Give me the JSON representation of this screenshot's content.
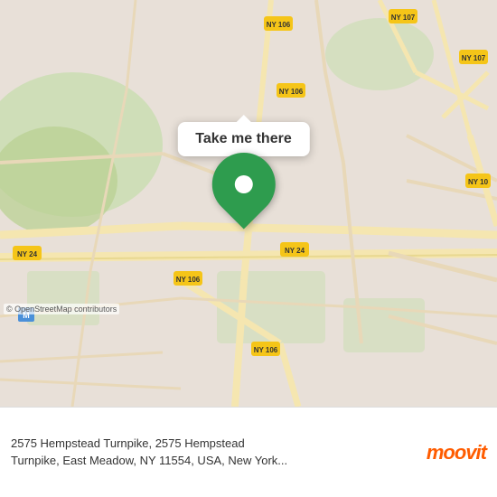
{
  "map": {
    "attribution": "© OpenStreetMap contributors",
    "center_lat": 40.72,
    "center_lng": -73.56
  },
  "marker": {
    "callout_label": "Take me there"
  },
  "bottom_bar": {
    "address_line1": "2575 Hempstead Turnpike, 2575 Hempstead",
    "address_line2": "Turnpike, East Meadow, NY 11554, USA, New York..."
  },
  "moovit": {
    "logo_m": "m",
    "logo_text": "moovit"
  },
  "route_badges": [
    {
      "label": "NY 106",
      "color": "#f5c518"
    },
    {
      "label": "NY 107",
      "color": "#f5c518"
    },
    {
      "label": "NY 24",
      "color": "#f5c518"
    },
    {
      "label": "NY 10",
      "color": "#f5c518"
    }
  ]
}
